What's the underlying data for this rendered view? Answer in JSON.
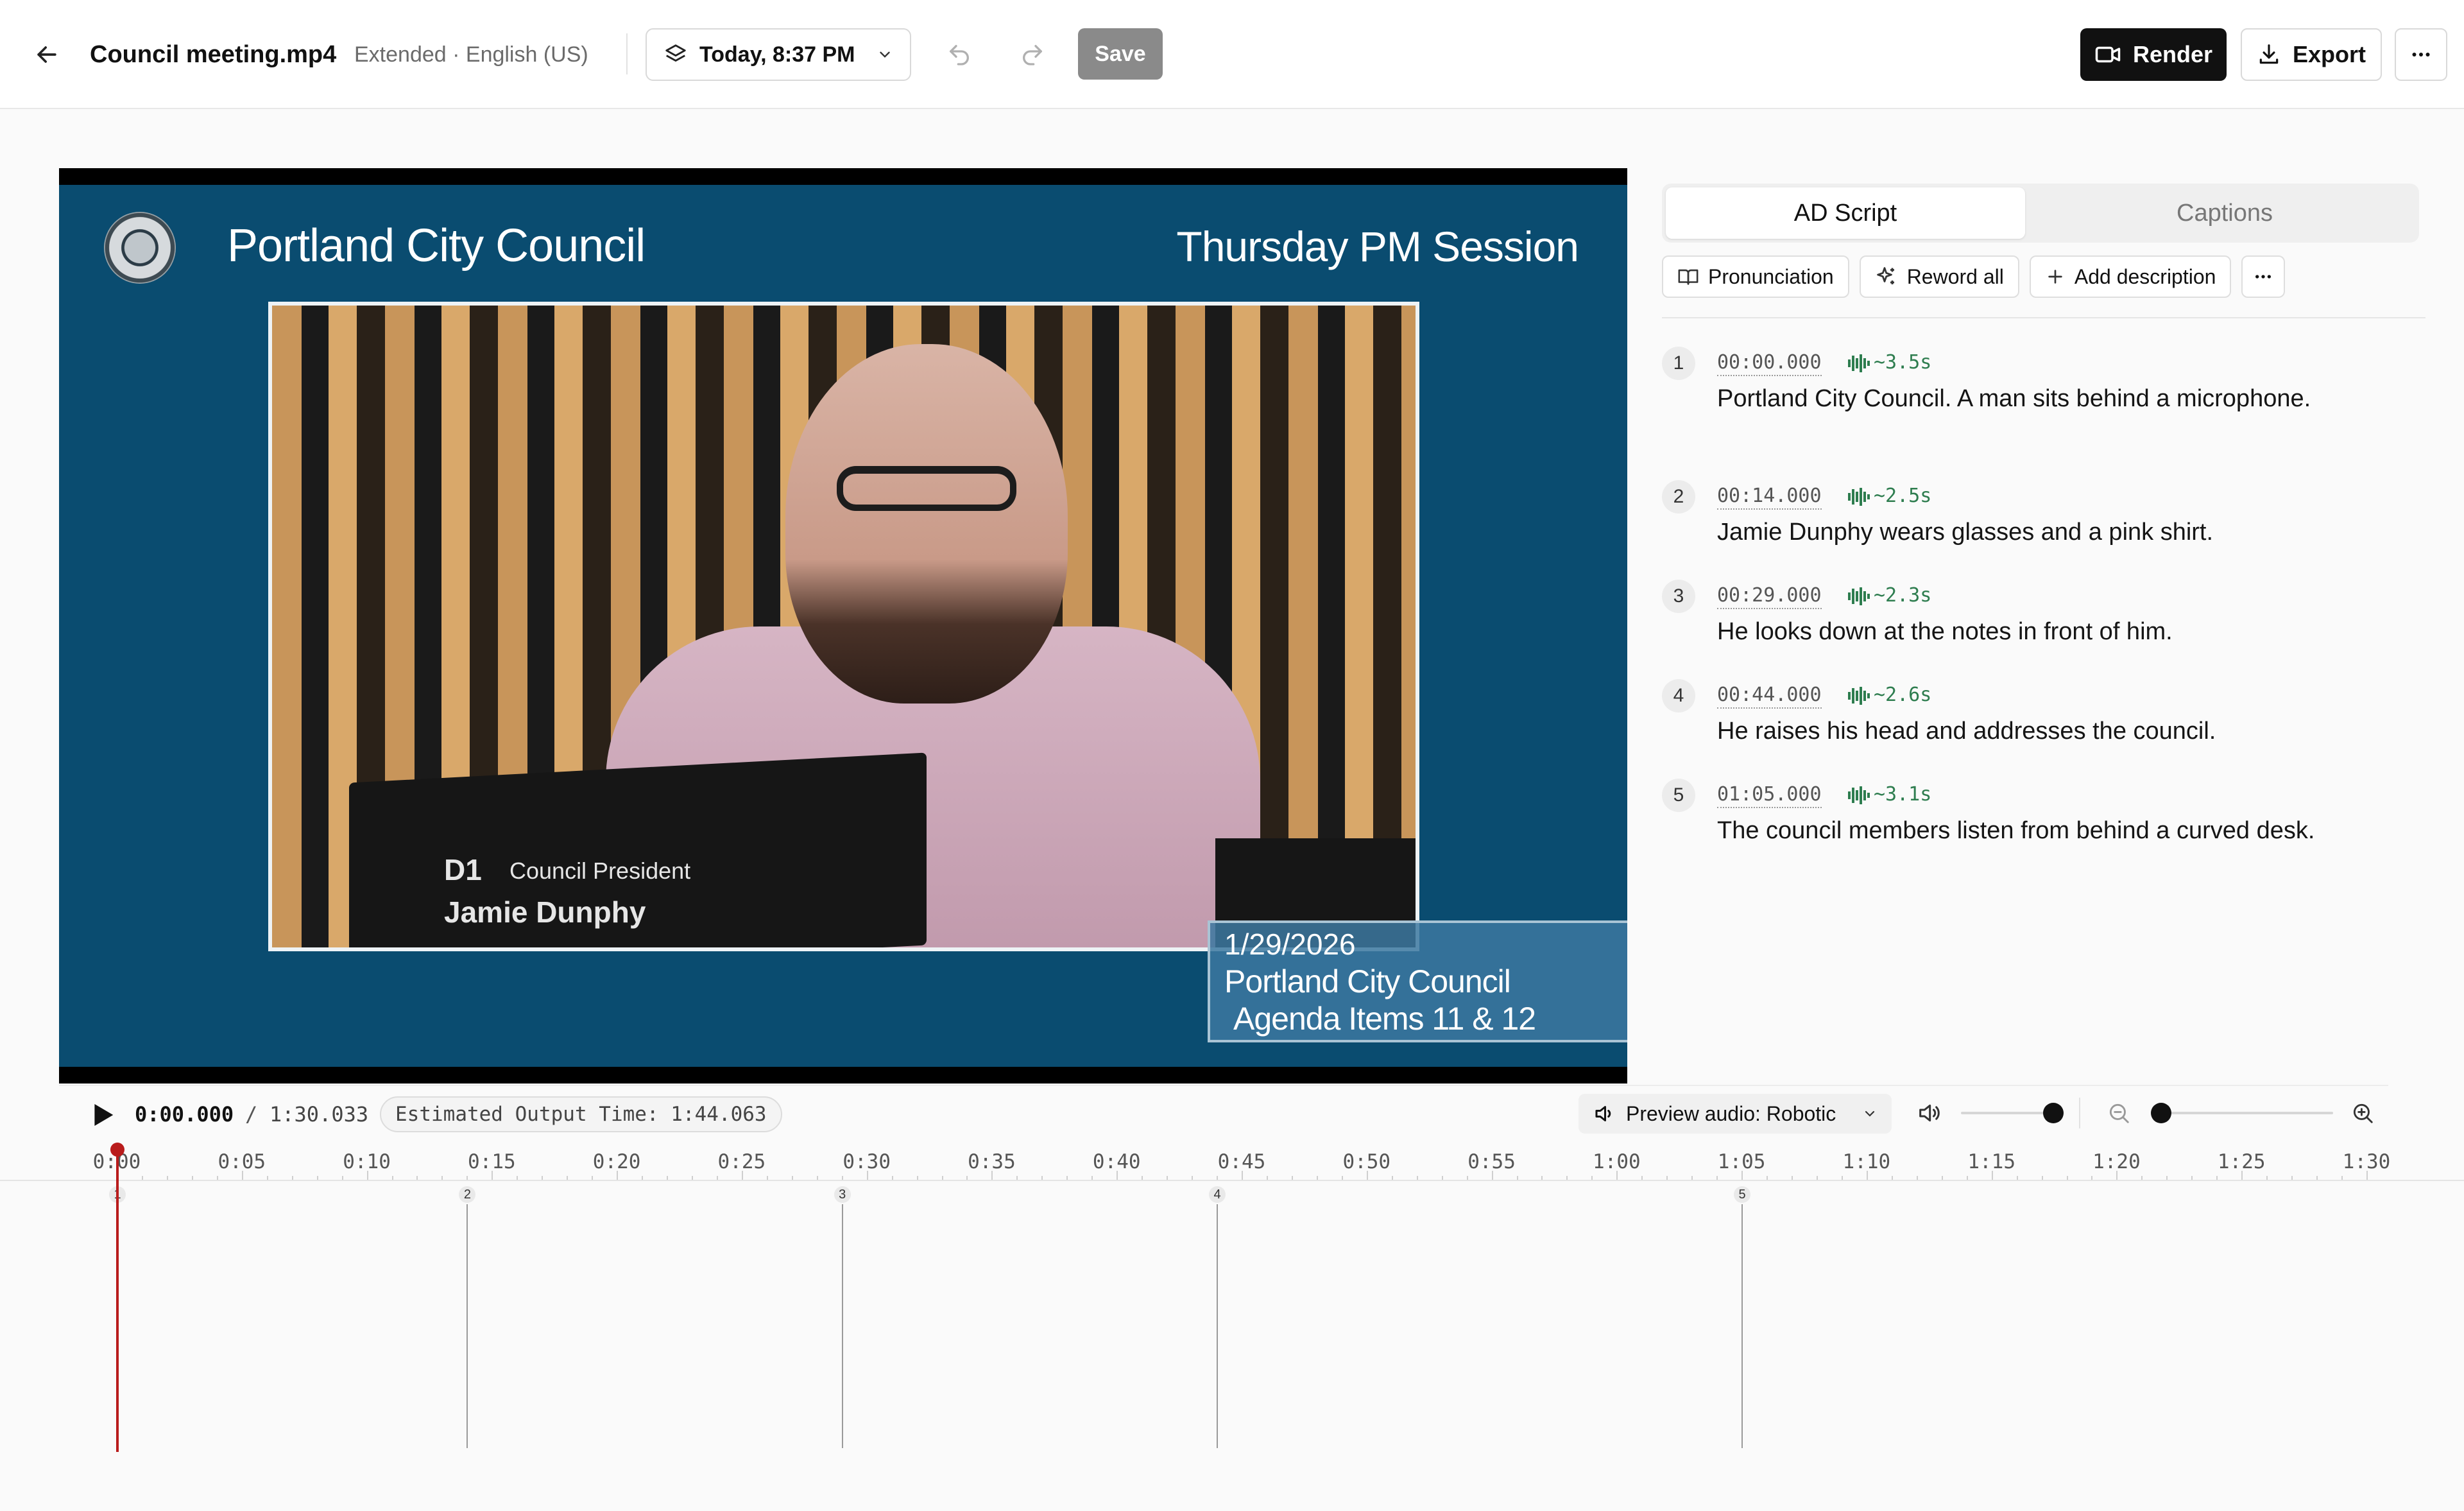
{
  "header": {
    "file_name": "Council meeting.mp4",
    "file_meta": "Extended · English (US)",
    "version_label": "Today, 8:37 PM",
    "save_label": "Save",
    "render_label": "Render",
    "export_label": "Export"
  },
  "video": {
    "council_name": "Portland City Council",
    "session_name": "Thursday PM Session",
    "nameplate_seat": "D1",
    "nameplate_role": "Council President",
    "nameplate_name": "Jamie Dunphy",
    "lower_third_date": "1/29/2026",
    "lower_third_line1": "Portland City Council",
    "lower_third_line2": "Agenda Items 11 & 12"
  },
  "side": {
    "tabs": [
      {
        "label": "AD Script",
        "active": true
      },
      {
        "label": "Captions",
        "active": false
      }
    ],
    "tools": {
      "pronunciation": "Pronunciation",
      "reword_all": "Reword all",
      "add_description": "Add description"
    },
    "script": [
      {
        "num": "1",
        "timestamp": "00:00.000",
        "duration": "~3.5s",
        "text": "Portland City Council. A man sits behind a microphone."
      },
      {
        "num": "2",
        "timestamp": "00:14.000",
        "duration": "~2.5s",
        "text": "Jamie Dunphy wears glasses and a pink shirt."
      },
      {
        "num": "3",
        "timestamp": "00:29.000",
        "duration": "~2.3s",
        "text": "He looks down at the notes in front of him."
      },
      {
        "num": "4",
        "timestamp": "00:44.000",
        "duration": "~2.6s",
        "text": "He raises his head and addresses the council."
      },
      {
        "num": "5",
        "timestamp": "01:05.000",
        "duration": "~3.1s",
        "text": "The council members listen from behind a curved desk."
      }
    ]
  },
  "transport": {
    "current_time": "0:00.000",
    "separator": "/",
    "total_time": "1:30.033",
    "estimated_output": "Estimated Output Time: 1:44.063",
    "preview_audio": "Preview audio: Robotic",
    "volume_level": 0.9,
    "zoom_level": 0.0
  },
  "timeline": {
    "ruler_labels": [
      "0:00",
      "0:05",
      "0:10",
      "0:15",
      "0:20",
      "0:25",
      "0:30",
      "0:35",
      "0:40",
      "0:45",
      "0:50",
      "0:55",
      "1:00",
      "1:05",
      "1:10",
      "1:15",
      "1:20",
      "1:25",
      "1:30"
    ],
    "marker_seconds": [
      0,
      14,
      29,
      44,
      65
    ],
    "marker_labels": [
      "1",
      "2",
      "3",
      "4",
      "5"
    ],
    "playhead_seconds": 0
  },
  "colors": {
    "accent_green": "#2e7d4f",
    "playhead_red": "#b91c1c",
    "video_blue": "#0a4c70"
  },
  "icons": {
    "back": "arrow-left-icon",
    "version": "layers-icon",
    "undo": "undo-icon",
    "redo": "redo-icon",
    "render": "video-camera-icon",
    "export": "download-icon",
    "more": "more-horizontal-icon",
    "pronunciation": "book-open-icon",
    "reword": "sparkles-icon",
    "add": "plus-icon",
    "wave": "audio-wave-icon",
    "play": "play-icon",
    "speaker": "speaker-icon",
    "zoom_out": "zoom-out-icon",
    "zoom_in": "zoom-in-icon"
  }
}
